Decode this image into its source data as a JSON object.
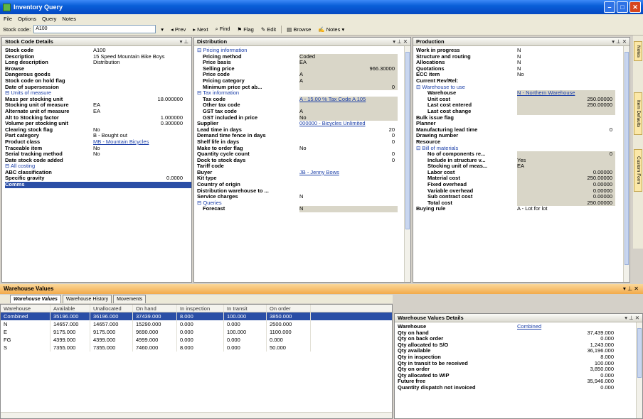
{
  "window": {
    "title": "Inventory Query"
  },
  "menu": [
    "File",
    "Options",
    "Query",
    "Notes"
  ],
  "toolbar": {
    "stock_code_label": "Stock code:",
    "stock_code_value": "A100",
    "prev": "Prev",
    "next": "Next",
    "find": "Find",
    "flag": "Flag",
    "edit": "Edit",
    "browse": "Browse",
    "notes": "Notes"
  },
  "stock_pane": {
    "title": "Stock Code Details",
    "rows": [
      {
        "label": "Stock code",
        "value": "A100"
      },
      {
        "label": "Description",
        "value": "15 Speed Mountain Bike Boys"
      },
      {
        "label": "Long description",
        "value": "Distribution"
      },
      {
        "label": "Browse",
        "value": ""
      },
      {
        "label": "Dangerous goods",
        "value": ""
      },
      {
        "label": "Stock code on hold flag",
        "value": ""
      },
      {
        "label": "Date of supersession",
        "value": ""
      },
      {
        "group": "Units of measure"
      },
      {
        "label": "Mass per stocking unit",
        "value": "18.000000"
      },
      {
        "label": "Stocking unit of measure",
        "value": "EA"
      },
      {
        "label": "Alternate unit of measure",
        "value": "EA"
      },
      {
        "label": "Alt to Stocking factor",
        "value": "1.000000"
      },
      {
        "label": "Volume per stocking unit",
        "value": "0.300000"
      },
      {
        "label": "Clearing stock flag",
        "value": "No"
      },
      {
        "label": "Part category",
        "value": "B - Bought out"
      },
      {
        "label": "Product class",
        "value": "MB - Mountain Bicycles",
        "link": true
      },
      {
        "label": "Traceable item",
        "value": "No"
      },
      {
        "label": "Serial tracking method",
        "value": "No"
      },
      {
        "label": "Date stock code added",
        "value": ""
      },
      {
        "group": "All costing"
      },
      {
        "label": "ABC classification",
        "value": ""
      },
      {
        "label": "Specific gravity",
        "value": "0.0000"
      },
      {
        "label": "Comms",
        "value": "",
        "selected": true
      }
    ]
  },
  "dist_pane": {
    "title": "Distribution",
    "rows": [
      {
        "group": "Pricing information"
      },
      {
        "label": "Pricing method",
        "value": "Coded",
        "ind": 1,
        "shade": true
      },
      {
        "label": "Price basis",
        "value": "EA",
        "ind": 1,
        "shade": true
      },
      {
        "label": "Selling price",
        "value": "966.30000",
        "ind": 1,
        "shade": true
      },
      {
        "label": "Price code",
        "value": "A",
        "ind": 1,
        "shade": true
      },
      {
        "label": "Pricing category",
        "value": "A",
        "ind": 1,
        "shade": true
      },
      {
        "label": "Minimum price pct ab...",
        "value": "0",
        "ind": 1,
        "shade": true
      },
      {
        "group": "Tax information"
      },
      {
        "label": "Tax code",
        "value": "A - 15.00 % Tax Code A 105",
        "ind": 1,
        "shade": true,
        "link": true
      },
      {
        "label": "Other tax code",
        "value": "",
        "ind": 1,
        "shade": true
      },
      {
        "label": "GST tax code",
        "value": "A",
        "ind": 1,
        "shade": true
      },
      {
        "label": "GST included in price",
        "value": "No",
        "ind": 1,
        "shade": true
      },
      {
        "label": "Supplier",
        "value": "000000 - Bicycles Unlimited",
        "link": true
      },
      {
        "label": "Lead time in days",
        "value": "20"
      },
      {
        "label": "Demand time fence in days",
        "value": "0"
      },
      {
        "label": "Shelf life in days",
        "value": "0"
      },
      {
        "label": "Make to order flag",
        "value": "No"
      },
      {
        "label": "Quantity cycle count",
        "value": "0"
      },
      {
        "label": "Dock to stock days",
        "value": "0"
      },
      {
        "label": "Tariff code",
        "value": ""
      },
      {
        "label": "Buyer",
        "value": "JB - Jenny Bows",
        "link": true
      },
      {
        "label": "Kit type",
        "value": ""
      },
      {
        "label": "Country of origin",
        "value": ""
      },
      {
        "label": "Distribution warehouse to ...",
        "value": ""
      },
      {
        "label": "Service charges",
        "value": "N"
      },
      {
        "group": "Queries"
      },
      {
        "label": "Forecast",
        "value": "N",
        "ind": 1,
        "shade": true
      }
    ]
  },
  "prod_pane": {
    "title": "Production",
    "rows": [
      {
        "label": "Work in progress",
        "value": "N"
      },
      {
        "label": "Structure and routing",
        "value": "N"
      },
      {
        "label": "Allocations",
        "value": "N"
      },
      {
        "label": "Quotations",
        "value": "N"
      },
      {
        "label": "ECC item",
        "value": "No"
      },
      {
        "label": "Current Rev/Rel:",
        "value": ""
      },
      {
        "group": "Warehouse to use"
      },
      {
        "label": "Warehouse",
        "value": "N - Northern Warehouse",
        "ind": 2,
        "shade": true,
        "link": true
      },
      {
        "label": "Unit cost",
        "value": "250.00000",
        "ind": 2,
        "shade": true
      },
      {
        "label": "Last cost entered",
        "value": "250.00000",
        "ind": 2,
        "shade": true
      },
      {
        "label": "Last cost change",
        "value": "",
        "ind": 2,
        "shade": true
      },
      {
        "label": "Bulk issue flag",
        "value": ""
      },
      {
        "label": "Planner",
        "value": ""
      },
      {
        "label": "Manufacturing lead time",
        "value": "0"
      },
      {
        "label": "Drawing number",
        "value": ""
      },
      {
        "label": "Resource",
        "value": ""
      },
      {
        "group": "Bill of materials"
      },
      {
        "label": "No of components re...",
        "value": "0",
        "ind": 2,
        "shade": true
      },
      {
        "label": "Include in structure v...",
        "value": "Yes",
        "ind": 2,
        "shade": true
      },
      {
        "label": "Stocking unit of meas...",
        "value": "EA",
        "ind": 2,
        "shade": true
      },
      {
        "label": "Labor cost",
        "value": "0.00000",
        "ind": 2,
        "shade": true
      },
      {
        "label": "Material cost",
        "value": "250.00000",
        "ind": 2,
        "shade": true
      },
      {
        "label": "Fixed overhead",
        "value": "0.00000",
        "ind": 2,
        "shade": true
      },
      {
        "label": "Variable overhead",
        "value": "0.00000",
        "ind": 2,
        "shade": true
      },
      {
        "label": "Sub contract cost",
        "value": "0.00000",
        "ind": 2,
        "shade": true
      },
      {
        "label": "Total cost",
        "value": "250.00000",
        "ind": 2,
        "shade": true
      },
      {
        "label": "Buying rule",
        "value": "A - Lot for lot"
      }
    ]
  },
  "side_tabs": [
    "Notes",
    "Item Defaults",
    "Custom Form"
  ],
  "warehouse": {
    "title": "Warehouse Values",
    "tabs": [
      "Warehouse Values",
      "Warehouse History",
      "Movements"
    ],
    "columns": [
      "Warehouse",
      "Available",
      "Unallocated",
      "On hand",
      "In inspection",
      "In transit",
      "On order"
    ],
    "rows": [
      [
        "Combined",
        "35196.000",
        "36196.000",
        "37439.000",
        "8.000",
        "100.000",
        "3850.000"
      ],
      [
        "N",
        "14657.000",
        "14657.000",
        "15290.000",
        "0.000",
        "0.000",
        "2500.000"
      ],
      [
        "E",
        "9175.000",
        "9175.000",
        "9690.000",
        "0.000",
        "100.000",
        "1100.000"
      ],
      [
        "FG",
        "4399.000",
        "4399.000",
        "4999.000",
        "0.000",
        "0.000",
        "0.000"
      ],
      [
        "S",
        "7355.000",
        "7355.000",
        "7460.000",
        "8.000",
        "0.000",
        "50.000"
      ]
    ]
  },
  "details": {
    "title": "Warehouse Values Details",
    "rows": [
      {
        "label": "Warehouse",
        "value": "Combined",
        "link": true
      },
      {
        "label": "Qty on hand",
        "value": "37,439.000"
      },
      {
        "label": "Qty on back order",
        "value": "0.000"
      },
      {
        "label": "Qty allocated to S/O",
        "value": "1,243.000"
      },
      {
        "label": "Qty available",
        "value": "36,196.000"
      },
      {
        "label": "Qty in inspection",
        "value": "8.000"
      },
      {
        "label": "Qty in transit to be received",
        "value": "100.000"
      },
      {
        "label": "Qty on order",
        "value": "3,850.000"
      },
      {
        "label": "Qty allocated to WIP",
        "value": "0.000"
      },
      {
        "label": "Future free",
        "value": "35,946.000"
      },
      {
        "label": "Quantity dispatch not invoiced",
        "value": "0.000"
      }
    ]
  }
}
